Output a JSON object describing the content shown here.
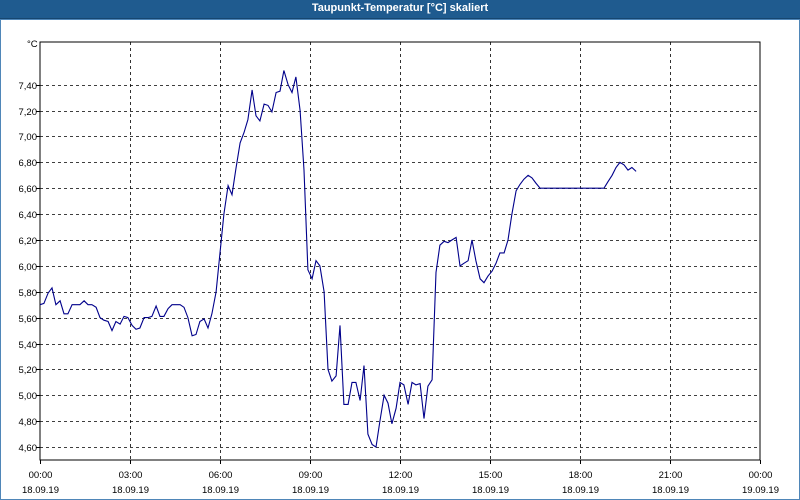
{
  "window": {
    "title": "Taupunkt-Temperatur [°C] skaliert"
  },
  "chart_data": {
    "type": "line",
    "title": "Taupunkt-Temperatur [°C] skaliert",
    "ylabel": "°C",
    "xlabel": "",
    "ylim": [
      4.5,
      7.73
    ],
    "grid": true,
    "y_ticks": [
      "7,40",
      "7,20",
      "7,00",
      "6,80",
      "6,60",
      "6,40",
      "6,20",
      "6,00",
      "5,80",
      "5,60",
      "5,40",
      "5,20",
      "5,00",
      "4,80",
      "4,60"
    ],
    "y_tick_values": [
      7.4,
      7.2,
      7.0,
      6.8,
      6.6,
      6.4,
      6.2,
      6.0,
      5.8,
      5.6,
      5.4,
      5.2,
      5.0,
      4.8,
      4.6
    ],
    "x_ticks": [
      {
        "time": "00:00",
        "date": "18.09.19"
      },
      {
        "time": "03:00",
        "date": "18.09.19"
      },
      {
        "time": "06:00",
        "date": "18.09.19"
      },
      {
        "time": "09:00",
        "date": "18.09.19"
      },
      {
        "time": "12:00",
        "date": "18.09.19"
      },
      {
        "time": "15:00",
        "date": "18.09.19"
      },
      {
        "time": "18:00",
        "date": "18.09.19"
      },
      {
        "time": "21:00",
        "date": "18.09.19"
      },
      {
        "time": "00:00",
        "date": "19.09.19"
      }
    ],
    "series": [
      {
        "color": "#00008b",
        "x_hours": [
          0,
          0.13,
          0.27,
          0.4,
          0.53,
          0.67,
          0.8,
          0.93,
          1.07,
          1.2,
          1.33,
          1.47,
          1.6,
          1.73,
          1.87,
          2.0,
          2.13,
          2.27,
          2.4,
          2.53,
          2.67,
          2.8,
          2.93,
          3.07,
          3.2,
          3.33,
          3.47,
          3.6,
          3.73,
          3.87,
          4.0,
          4.13,
          4.27,
          4.4,
          4.53,
          4.67,
          4.8,
          4.93,
          5.07,
          5.2,
          5.33,
          5.47,
          5.6,
          5.73,
          5.87,
          6.0,
          6.13,
          6.27,
          6.4,
          6.53,
          6.67,
          6.8,
          6.93,
          7.07,
          7.2,
          7.33,
          7.47,
          7.6,
          7.73,
          7.87,
          8.0,
          8.13,
          8.27,
          8.4,
          8.53,
          8.67,
          8.8,
          8.93,
          9.07,
          9.2,
          9.33,
          9.47,
          9.6,
          9.73,
          9.87,
          10.0,
          10.13,
          10.27,
          10.4,
          10.53,
          10.67,
          10.8,
          10.93,
          11.07,
          11.2,
          11.33,
          11.47,
          11.6,
          11.73,
          11.87,
          12.0,
          12.13,
          12.27,
          12.4,
          12.53,
          12.67,
          12.8,
          12.93,
          13.07,
          13.2,
          13.33,
          13.47,
          13.6,
          13.73,
          13.87,
          14.0,
          14.13,
          14.27,
          14.4,
          14.53,
          14.67,
          14.8,
          14.93,
          15.07,
          15.2,
          15.33,
          15.47,
          15.6,
          15.73,
          15.87,
          16.0,
          16.13,
          16.27,
          16.4,
          16.53,
          16.67,
          16.8,
          16.93,
          17.07,
          17.2,
          17.33,
          17.47,
          17.6,
          17.73,
          17.87,
          18.0,
          18.13,
          18.27,
          18.4,
          18.53,
          18.67,
          18.8,
          18.93,
          19.07,
          19.2,
          19.33,
          19.47,
          19.6,
          19.73,
          19.87,
          20.0,
          20.13,
          20.27,
          20.4,
          20.53,
          20.67,
          20.8,
          20.93,
          21.07,
          21.2,
          21.33,
          21.47,
          21.6,
          21.73,
          21.87,
          22.0,
          22.13,
          22.27,
          22.4,
          22.53,
          22.67,
          22.8,
          22.93,
          23.07,
          23.2,
          23.33,
          23.47,
          23.6,
          23.73,
          23.87,
          24.0
        ],
        "values": [
          5.7,
          5.71,
          5.79,
          5.83,
          5.7,
          5.73,
          5.63,
          5.63,
          5.7,
          5.7,
          5.7,
          5.73,
          5.7,
          5.7,
          5.68,
          5.6,
          5.58,
          5.57,
          5.5,
          5.57,
          5.55,
          5.61,
          5.6,
          5.54,
          5.51,
          5.52,
          5.6,
          5.6,
          5.61,
          5.69,
          5.61,
          5.61,
          5.67,
          5.7,
          5.7,
          5.7,
          5.68,
          5.6,
          5.46,
          5.47,
          5.57,
          5.59,
          5.52,
          5.63,
          5.8,
          6.1,
          6.4,
          6.62,
          6.55,
          6.75,
          6.95,
          7.03,
          7.13,
          7.36,
          7.16,
          7.12,
          7.25,
          7.24,
          7.19,
          7.34,
          7.35,
          7.51,
          7.4,
          7.34,
          7.46,
          7.2,
          6.74,
          5.97,
          5.9,
          6.04,
          6.0,
          5.8,
          5.2,
          5.11,
          5.15,
          5.54,
          4.93,
          4.93,
          5.1,
          5.1,
          4.96,
          5.23,
          4.7,
          4.62,
          4.6,
          4.8,
          5.0,
          4.94,
          4.78,
          4.9,
          5.1,
          5.08,
          4.93,
          5.1,
          5.08,
          5.09,
          4.82,
          5.07,
          5.12,
          5.95,
          6.16,
          6.19,
          6.18,
          6.2,
          6.22,
          6.0,
          6.02,
          6.04,
          6.2,
          6.04,
          5.9,
          5.87,
          5.92,
          5.96,
          6.02,
          6.1,
          6.1,
          6.2,
          6.4,
          6.58,
          6.63,
          6.67,
          6.7,
          6.68,
          6.64,
          6.6,
          6.6,
          6.6,
          6.6,
          6.6,
          6.6,
          6.6,
          6.6,
          6.6,
          6.6,
          6.6,
          6.6,
          6.6,
          6.6,
          6.6,
          6.6,
          6.6,
          6.65,
          6.7,
          6.76,
          6.8,
          6.78,
          6.74,
          6.76,
          6.73
        ]
      }
    ]
  }
}
